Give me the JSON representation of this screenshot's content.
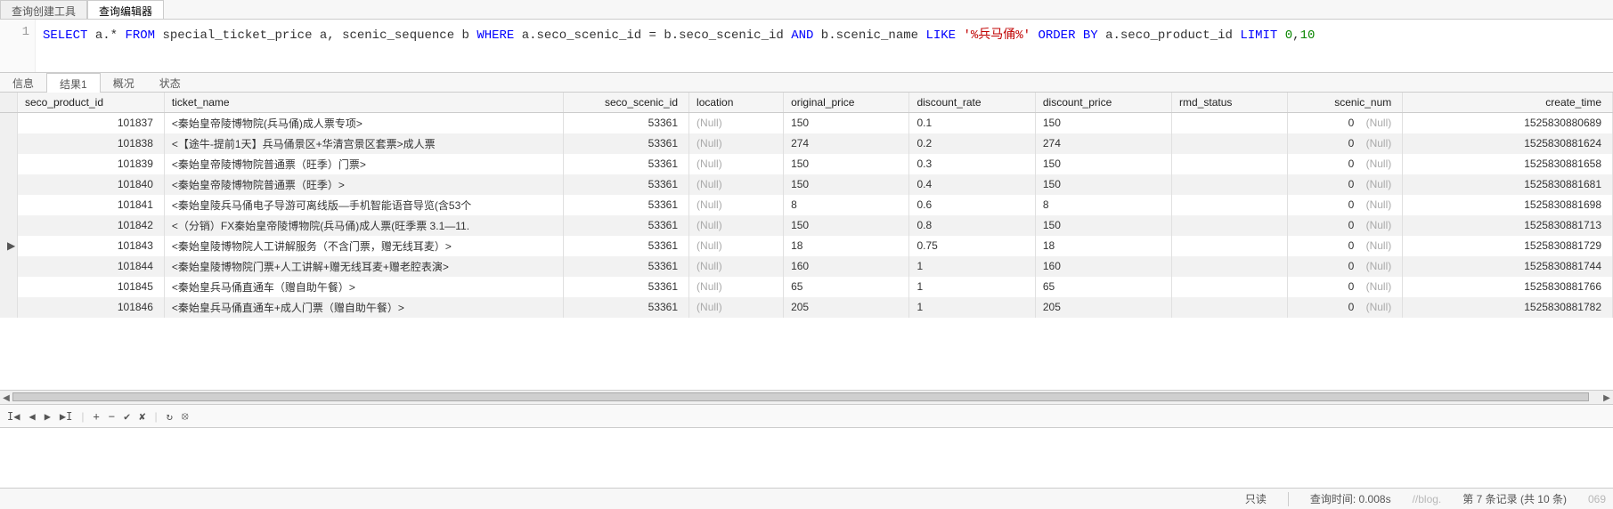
{
  "topTabs": {
    "tool": "查询创建工具",
    "editor": "查询编辑器"
  },
  "sql": {
    "lineNo": "1",
    "t1": "SELECT",
    "t2": " a.* ",
    "t3": "FROM",
    "t4": " special_ticket_price a, scenic_sequence b ",
    "t5": "WHERE",
    "t6": " a.seco_scenic_id = b.seco_scenic_id ",
    "t7": "AND",
    "t8": " b.scenic_name ",
    "t9": "LIKE",
    "t10": " ",
    "t11": "'%兵马俑%'",
    "t12": " ",
    "t13": "ORDER BY",
    "t14": " a.seco_product_id ",
    "t15": "LIMIT",
    "t16": " ",
    "t17": "0",
    "t18": ",",
    "t19": "10"
  },
  "midTabs": {
    "info": "信息",
    "result": "结果1",
    "profile": "概况",
    "status": "状态"
  },
  "columns": {
    "seco_product_id": "seco_product_id",
    "ticket_name": "ticket_name",
    "seco_scenic_id": "seco_scenic_id",
    "location": "location",
    "original_price": "original_price",
    "discount_rate": "discount_rate",
    "discount_price": "discount_price",
    "rmd_status": "rmd_status",
    "scenic_num": "scenic_num",
    "create_time": "create_time"
  },
  "nullText": "(Null)",
  "rows": [
    {
      "pid": "101837",
      "name": "<秦始皇帝陵博物院(兵马俑)成人票专项>",
      "scenic": "53361",
      "loc": "(Null)",
      "oprice": "150",
      "drate": "0.1",
      "dprice": "150",
      "rmd": "",
      "snum": "0",
      "snull": "(Null)",
      "ctime": "1525830880689"
    },
    {
      "pid": "101838",
      "name": "<【途牛-提前1天】兵马俑景区+华清宫景区套票>成人票",
      "scenic": "53361",
      "loc": "(Null)",
      "oprice": "274",
      "drate": "0.2",
      "dprice": "274",
      "rmd": "",
      "snum": "0",
      "snull": "(Null)",
      "ctime": "1525830881624"
    },
    {
      "pid": "101839",
      "name": "<秦始皇帝陵博物院普通票（旺季）门票>",
      "scenic": "53361",
      "loc": "(Null)",
      "oprice": "150",
      "drate": "0.3",
      "dprice": "150",
      "rmd": "",
      "snum": "0",
      "snull": "(Null)",
      "ctime": "1525830881658"
    },
    {
      "pid": "101840",
      "name": "<秦始皇帝陵博物院普通票（旺季）>",
      "scenic": "53361",
      "loc": "(Null)",
      "oprice": "150",
      "drate": "0.4",
      "dprice": "150",
      "rmd": "",
      "snum": "0",
      "snull": "(Null)",
      "ctime": "1525830881681"
    },
    {
      "pid": "101841",
      "name": "<秦始皇陵兵马俑电子导游可离线版—手机智能语音导览(含53个",
      "scenic": "53361",
      "loc": "(Null)",
      "oprice": "8",
      "drate": "0.6",
      "dprice": "8",
      "rmd": "",
      "snum": "0",
      "snull": "(Null)",
      "ctime": "1525830881698"
    },
    {
      "pid": "101842",
      "name": "<（分销）FX秦始皇帝陵博物院(兵马俑)成人票(旺季票 3.1—11.",
      "scenic": "53361",
      "loc": "(Null)",
      "oprice": "150",
      "drate": "0.8",
      "dprice": "150",
      "rmd": "",
      "snum": "0",
      "snull": "(Null)",
      "ctime": "1525830881713"
    },
    {
      "pid": "101843",
      "name": "<秦始皇陵博物院人工讲解服务（不含门票，赠无线耳麦）>",
      "scenic": "53361",
      "loc": "(Null)",
      "oprice": "18",
      "drate": "0.75",
      "dprice": "18",
      "rmd": "",
      "snum": "0",
      "snull": "(Null)",
      "ctime": "1525830881729",
      "current": true
    },
    {
      "pid": "101844",
      "name": "<秦始皇陵博物院门票+人工讲解+赠无线耳麦+赠老腔表演>",
      "scenic": "53361",
      "loc": "(Null)",
      "oprice": "160",
      "drate": "1",
      "dprice": "160",
      "rmd": "",
      "snum": "0",
      "snull": "(Null)",
      "ctime": "1525830881744"
    },
    {
      "pid": "101845",
      "name": "<秦始皇兵马俑直通车（赠自助午餐）>",
      "scenic": "53361",
      "loc": "(Null)",
      "oprice": "65",
      "drate": "1",
      "dprice": "65",
      "rmd": "",
      "snum": "0",
      "snull": "(Null)",
      "ctime": "1525830881766"
    },
    {
      "pid": "101846",
      "name": "<秦始皇兵马俑直通车+成人门票（赠自助午餐）>",
      "scenic": "53361",
      "loc": "(Null)",
      "oprice": "205",
      "drate": "1",
      "dprice": "205",
      "rmd": "",
      "snum": "0",
      "snull": "(Null)",
      "ctime": "1525830881782"
    }
  ],
  "nav": {
    "first": "I◀",
    "prev": "◀",
    "next": "▶",
    "last": "▶I",
    "plus": "+",
    "minus": "−",
    "check": "✔",
    "cross": "✘",
    "refresh": "↻",
    "stop": "⦻"
  },
  "statusBar": {
    "readonly": "只读",
    "queryTime": "查询时间: 0.008s",
    "blog": "//blog.",
    "record": "第 7 条记录 (共 10 条)",
    "blognum": "069"
  }
}
